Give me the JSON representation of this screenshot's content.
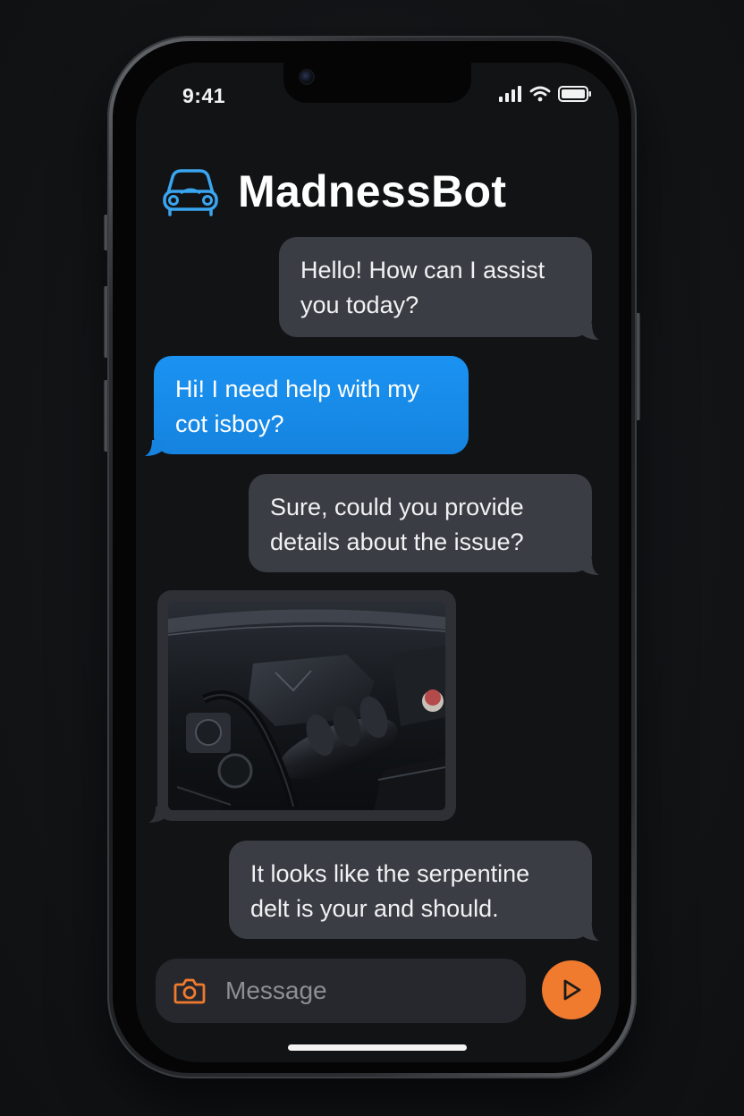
{
  "status_bar": {
    "time": "9:41"
  },
  "header": {
    "title": "MadnessBot",
    "logo_icon": "car-icon"
  },
  "messages": [
    {
      "sender": "bot",
      "text": "Hello! How can I assist you today?"
    },
    {
      "sender": "user",
      "text": "Hi! I need help with my cot isboy?"
    },
    {
      "sender": "bot",
      "text": "Sure, could you provide details about the issue?"
    },
    {
      "sender": "user",
      "type": "image",
      "image_desc_icon": "engine-photo"
    },
    {
      "sender": "bot",
      "text": "It looks like the serpentine delt is your and should."
    }
  ],
  "composer": {
    "placeholder": "Message",
    "camera_icon": "camera-icon",
    "send_icon": "send-icon"
  },
  "colors": {
    "background": "#121416",
    "screen": "#121315",
    "bot_bubble": "#3a3d44",
    "user_bubble": "#1b93f2",
    "accent_orange": "#f07a2e",
    "logo_blue": "#3aa6f0"
  }
}
